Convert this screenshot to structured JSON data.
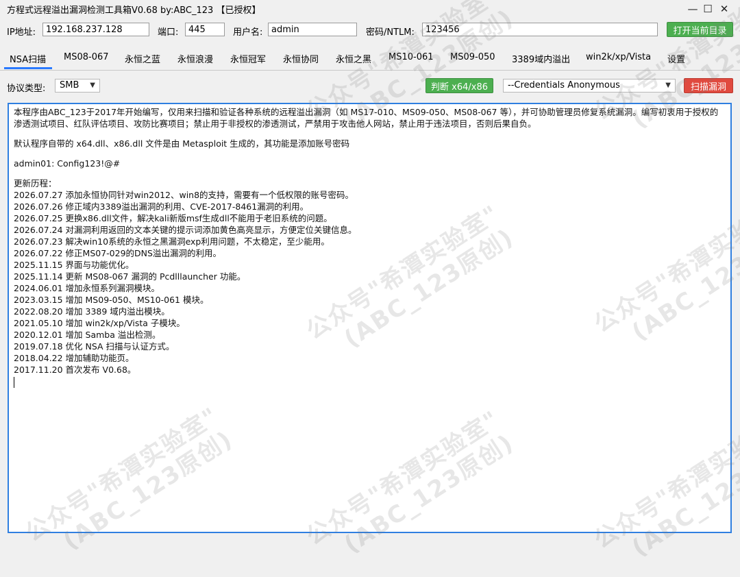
{
  "window": {
    "title": "方程式远程溢出漏洞检测工具箱V0.68 by:ABC_123 【已授权】",
    "minimize_glyph": "—",
    "maximize_glyph": "☐",
    "close_glyph": "✕"
  },
  "connection": {
    "ip_label": "IP地址:",
    "ip_value": "192.168.237.128",
    "port_label": "端口:",
    "port_value": "445",
    "user_label": "用户名:",
    "user_value": "admin",
    "pass_label": "密码/NTLM:",
    "pass_value": "123456",
    "open_dir_button": "打开当前目录"
  },
  "tabs": [
    {
      "label": "NSA扫描",
      "active": true
    },
    {
      "label": "MS08-067"
    },
    {
      "label": "永恒之蓝"
    },
    {
      "label": "永恒浪漫"
    },
    {
      "label": "永恒冠军"
    },
    {
      "label": "永恒协同"
    },
    {
      "label": "永恒之黑"
    },
    {
      "label": "MS10-061"
    },
    {
      "label": "MS09-050"
    },
    {
      "label": "3389域内溢出"
    },
    {
      "label": "win2k/xp/Vista"
    },
    {
      "label": "设置"
    }
  ],
  "options": {
    "protocol_label": "协议类型:",
    "protocol_value": "SMB",
    "detect_button": "判断 x64/x86",
    "credentials_value": "--Credentials Anonymous",
    "scan_button": "扫描漏洞"
  },
  "content": {
    "intro": "本程序由ABC_123于2017年开始编写，仅用来扫描和验证各种系统的远程溢出漏洞（如 MS17-010、MS09-050、MS08-067 等），并可协助管理员修复系统漏洞。编写初衷用于授权的渗透测试项目、红队评估项目、攻防比赛项目；禁止用于非授权的渗透测试，严禁用于攻击他人网站，禁止用于违法项目，否则后果自负。",
    "dll_note": "默认程序自带的 x64.dll、x86.dll 文件是由 Metasploit 生成的，其功能是添加账号密码",
    "account": "admin01: Config123!@#",
    "changelog_title": "更新历程：",
    "changelog": [
      "2026.07.27 添加永恒协同针对win2012、win8的支持，需要有一个低权限的账号密码。",
      "2026.07.26 修正域内3389溢出漏洞的利用、CVE-2017-8461漏洞的利用。",
      "2026.07.25 更换x86.dll文件，解决kali新版msf生成dll不能用于老旧系统的问题。",
      "2026.07.24 对漏洞利用返回的文本关键的提示词添加黄色高亮显示，方便定位关键信息。",
      "2026.07.23 解决win10系统的永恒之黑漏洞exp利用问题，不太稳定，至少能用。",
      "2026.07.22 修正MS07-029的DNS溢出漏洞的利用。",
      "2025.11.15 界面与功能优化。",
      "2025.11.14 更新 MS08-067 漏洞的 Pcdlllauncher 功能。",
      "2024.06.01 增加永恒系列漏洞模块。",
      "2023.03.15 增加 MS09-050、MS10-061 模块。",
      "2022.08.20 增加 3389 域内溢出模块。",
      "2021.05.10 增加 win2k/xp/Vista 子模块。",
      "2020.12.01 增加 Samba 溢出检测。",
      "2019.07.18 优化 NSA 扫描与认证方式。",
      "2018.04.22 增加辅助功能页。",
      "2017.11.20 首次发布 V0.68。"
    ]
  },
  "watermark": {
    "line1": "公众号\"希潭实验室\"",
    "line2": "(ABC_123原创)"
  },
  "colors": {
    "accent_blue": "#2f7fe0",
    "tab_underline": "#2979ff",
    "button_green": "#4caf50",
    "button_red": "#e04a3f"
  }
}
